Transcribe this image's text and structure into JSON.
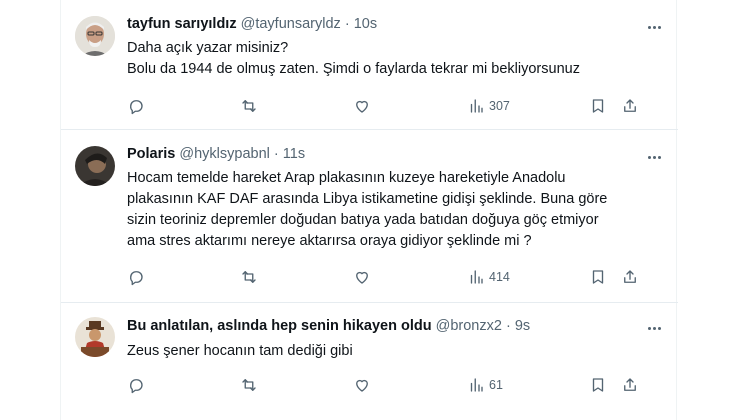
{
  "tweets": [
    {
      "name": "tayfun sarıyıldız",
      "handle": "@tayfunsaryldz",
      "time": "10s",
      "lines": [
        "Daha açık yazar misiniz?",
        "Bolu da 1944 de olmuş zaten. Şimdi o faylarda tekrar mi bekliyorsunuz"
      ],
      "views": "307"
    },
    {
      "name": "Polaris",
      "handle": "@hyklsypabnl",
      "time": "11s",
      "lines": [
        "Hocam temelde hareket Arap plakasının kuzeye hareketiyle Anadolu",
        "plakasının KAF DAF arasında Libya istikametine gidişi şeklinde. Buna göre",
        "sizin teoriniz depremler doğudan batıya yada batıdan doğuya göç etmiyor",
        "ama stres aktarımı nereye aktarırsa oraya gidiyor şeklinde mi ?"
      ],
      "views": "414"
    },
    {
      "name": "Bu anlatılan, aslında hep senin hikayen oldu",
      "handle": "@bronzx2",
      "time": "9s",
      "lines": [
        "Zeus şener hocanın tam dediği gibi"
      ],
      "views": "61"
    }
  ],
  "separator": "·",
  "icons": [
    "reply-icon",
    "retweet-icon",
    "like-icon",
    "views-icon",
    "bookmark-icon",
    "share-icon",
    "more-icon"
  ],
  "colors": {
    "text": "#0f1419",
    "secondary": "#536471",
    "border": "#e6ecf0"
  }
}
